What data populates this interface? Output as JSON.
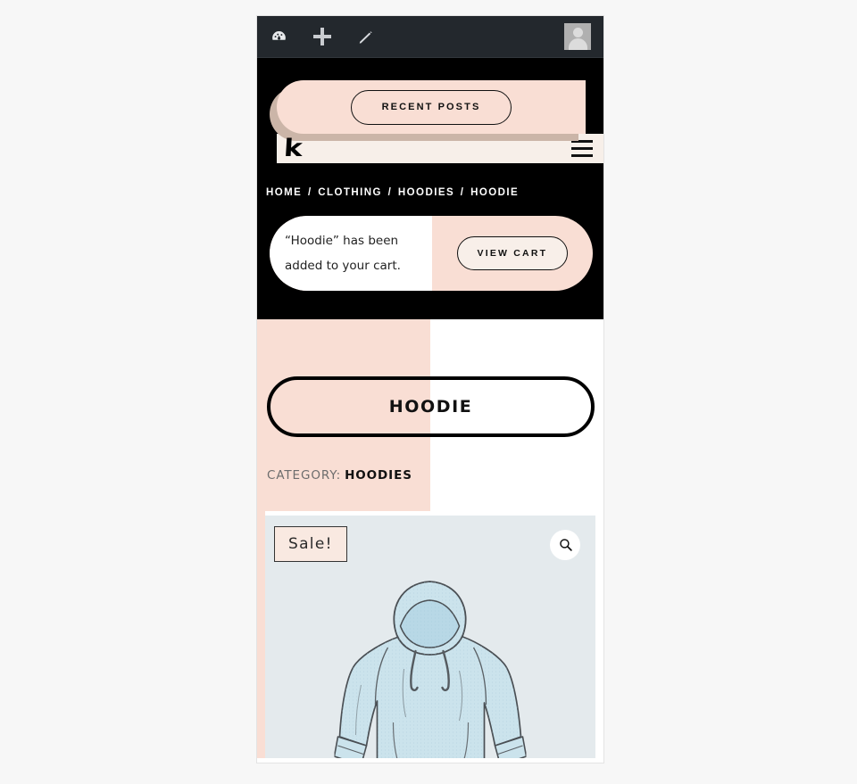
{
  "admin_bar": {
    "items": [
      {
        "name": "dashboard-icon",
        "label": "Dashboard"
      },
      {
        "name": "new-content-icon",
        "label": "New"
      },
      {
        "name": "edit-icon",
        "label": "Edit"
      }
    ],
    "avatar_label": "My Account",
    "background": "#23282d"
  },
  "header": {
    "topbar_button": "RECENT POSTS",
    "logo_text": "k",
    "menu_label": "Menu",
    "background": "#000000",
    "accent_pink": "#f9ded4",
    "shadow_beige": "#cbb5a8",
    "nav_bg": "#f7efe9"
  },
  "breadcrumb": {
    "separator": "/",
    "items": [
      {
        "label": "HOME",
        "current": false
      },
      {
        "label": "CLOTHING",
        "current": false
      },
      {
        "label": "HOODIES",
        "current": false
      },
      {
        "label": "HOODIE",
        "current": true
      }
    ]
  },
  "cart_notice": {
    "message": "“Hoodie” has been added to your cart.",
    "button_label": "VIEW CART",
    "panel_bg": "#f9ded4",
    "message_bg": "#ffffff"
  },
  "product": {
    "title": "HOODIE",
    "category_label": "CATEGORY:",
    "category_value": "HOODIES",
    "sale_badge": "Sale!",
    "zoom_label": "Zoom",
    "zoom_icon": "search-icon",
    "gallery_bg": "#e4eaed",
    "image_alt": "Light blue hoodie illustration"
  }
}
